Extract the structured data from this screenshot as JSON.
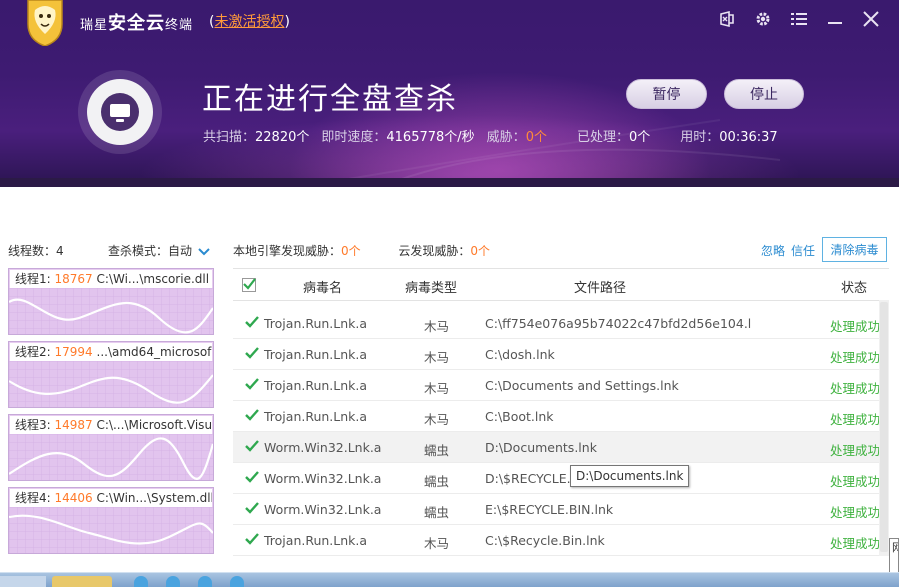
{
  "header": {
    "brand": "瑞星",
    "product": "安全云",
    "suffix": "终端",
    "license_open": "(",
    "license_link": "未激活授权",
    "license_close": ")",
    "scan_title": "正在进行全盘查杀",
    "buttons": {
      "pause": "暂停",
      "stop": "停止"
    },
    "stats": {
      "scanned_label": "共扫描：",
      "scanned_value": "22820个",
      "speed_label": "即时速度：",
      "speed_value": "4165778个/秒",
      "threat_label": "威胁：",
      "threat_value": "0个",
      "processed_label": "已处理：",
      "processed_value": "0个",
      "time_label": "用时：",
      "time_value": "00:36:37"
    },
    "window_icons": [
      "skin-icon",
      "settings-icon",
      "menu-icon",
      "minimize-icon",
      "close-icon"
    ]
  },
  "left": {
    "thread_count_label": "线程数：",
    "thread_count_value": "4",
    "scan_mode_label": "查杀模式：",
    "scan_mode_value": "自动",
    "threads": [
      {
        "label": "线程1:",
        "count": "18767",
        "path": "C:\\Wi...\\mscorie.dll"
      },
      {
        "label": "线程2:",
        "count": "17994",
        "path": "...\\amd64_microsof"
      },
      {
        "label": "线程3:",
        "count": "14987",
        "path": "C:\\...\\Microsoft.VisualE"
      },
      {
        "label": "线程4:",
        "count": "14406",
        "path": "C:\\Win...\\System.dll"
      }
    ]
  },
  "right": {
    "local_label": "本地引擎发现威胁：",
    "local_value": "0个",
    "cloud_label": "云发现威胁：",
    "cloud_value": "0个",
    "ignore": "忽略",
    "trust": "信任",
    "clean": "清除病毒",
    "columns": [
      "病毒名",
      "病毒类型",
      "文件路径",
      "状态"
    ],
    "rows": [
      {
        "name": "Trojan.Run.Lnk.a",
        "type": "木马",
        "path": "C:\\ff754e076a95b74022c47bfd2d56e104.l",
        "status": "处理成功"
      },
      {
        "name": "Trojan.Run.Lnk.a",
        "type": "木马",
        "path": "C:\\dosh.lnk",
        "status": "处理成功"
      },
      {
        "name": "Trojan.Run.Lnk.a",
        "type": "木马",
        "path": "C:\\Documents and Settings.lnk",
        "status": "处理成功"
      },
      {
        "name": "Trojan.Run.Lnk.a",
        "type": "木马",
        "path": "C:\\Boot.lnk",
        "status": "处理成功"
      },
      {
        "name": "Worm.Win32.Lnk.a",
        "type": "蠕虫",
        "path": "D:\\Documents.lnk",
        "status": "处理成功"
      },
      {
        "name": "Worm.Win32.Lnk.a",
        "type": "蠕虫",
        "path": "D:\\$RECYCLE.B",
        "status": "处理成功"
      },
      {
        "name": "Worm.Win32.Lnk.a",
        "type": "蠕虫",
        "path": "E:\\$RECYCLE.BIN.lnk",
        "status": "处理成功"
      },
      {
        "name": "Trojan.Run.Lnk.a",
        "type": "木马",
        "path": "C:\\$Recycle.Bin.lnk",
        "status": "处理成功"
      }
    ],
    "tooltip": "D:\\Documents.lnk"
  },
  "side_tip": "网"
}
